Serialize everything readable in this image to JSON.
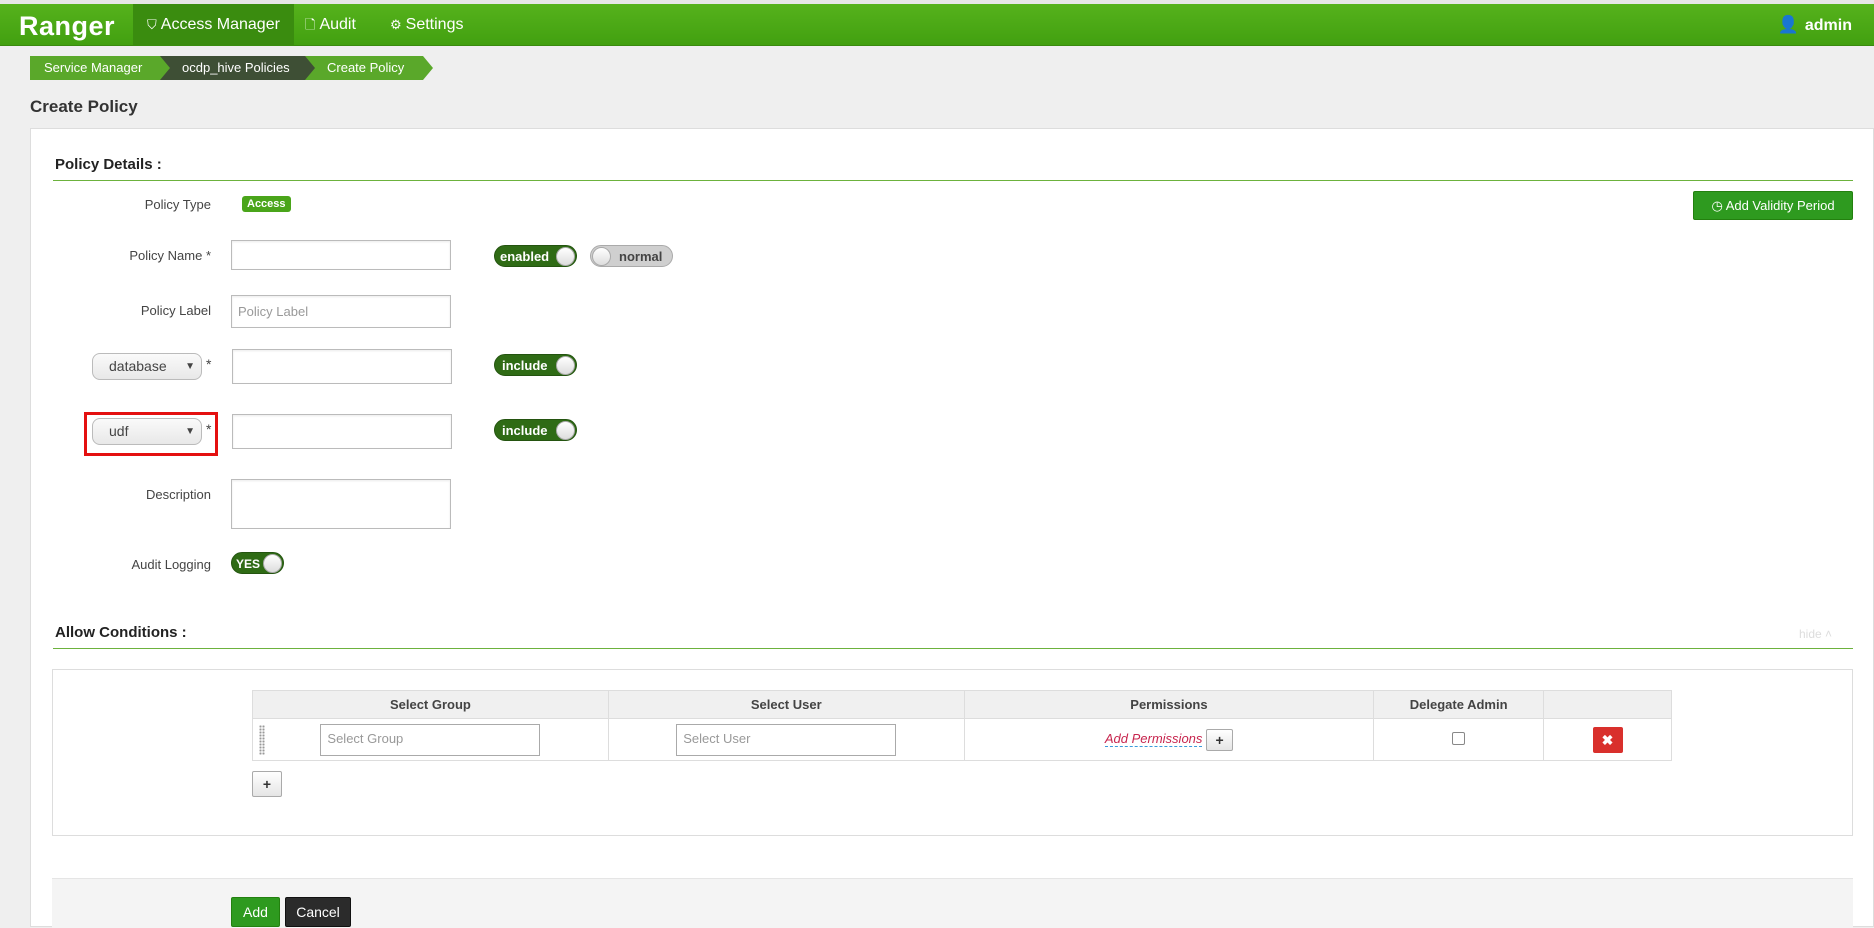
{
  "navbar": {
    "brand": "Ranger",
    "access_manager": "Access Manager",
    "audit": "Audit",
    "settings": "Settings",
    "user": "admin"
  },
  "breadcrumb": [
    "Service Manager",
    "ocdp_hive Policies",
    "Create Policy"
  ],
  "page_title": "Create Policy",
  "policy_details": {
    "title": "Policy Details :",
    "policy_type_label": "Policy Type",
    "policy_type_value": "Access",
    "validity_button": "Add Validity Period",
    "policy_name_label": "Policy Name *",
    "policy_name_value": "",
    "enabled_toggle": "enabled",
    "normal_toggle": "normal",
    "policy_label_label": "Policy Label",
    "policy_label_placeholder": "Policy Label",
    "resource1_select": "database",
    "resource1_required": "*",
    "resource1_toggle": "include",
    "resource2_select": "udf",
    "resource2_required": "*",
    "resource2_toggle": "include",
    "description_label": "Description",
    "audit_logging_label": "Audit Logging",
    "audit_logging_toggle": "YES"
  },
  "allow_conditions": {
    "title": "Allow Conditions :",
    "hide_link": "hide",
    "columns": [
      "Select Group",
      "Select User",
      "Permissions",
      "Delegate Admin",
      ""
    ],
    "row": {
      "group_placeholder": "Select Group",
      "user_placeholder": "Select User",
      "add_permissions": "Add Permissions",
      "plus": "+",
      "delete": "✖"
    },
    "add_row": "+"
  },
  "footer": {
    "add": "Add",
    "cancel": "Cancel"
  },
  "colors": {
    "navbar": "#4aa816",
    "accent": "#2e9a1f",
    "highlight": "#e41010",
    "danger": "#d9302c"
  }
}
